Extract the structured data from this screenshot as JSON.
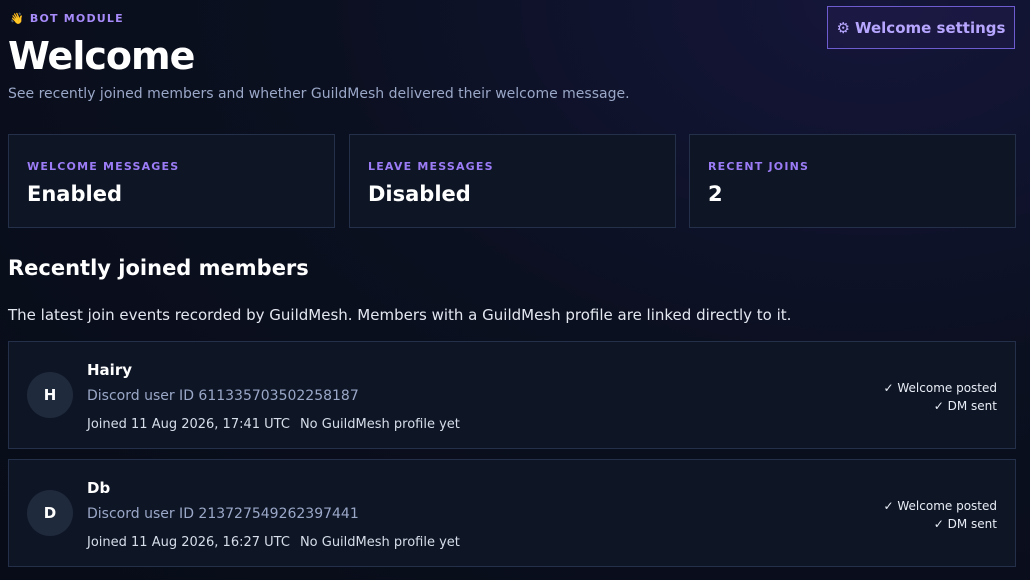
{
  "header": {
    "eyebrow_icon": "👋",
    "eyebrow": "BOT MODULE",
    "title": "Welcome",
    "subtitle": "See recently joined members and whether GuildMesh delivered their welcome message.",
    "settings_icon": "⚙",
    "settings_label": "Welcome settings"
  },
  "stats": [
    {
      "label": "WELCOME MESSAGES",
      "value": "Enabled"
    },
    {
      "label": "LEAVE MESSAGES",
      "value": "Disabled"
    },
    {
      "label": "RECENT JOINS",
      "value": "2"
    }
  ],
  "members_section": {
    "title": "Recently joined members",
    "description": "The latest join events recorded by GuildMesh. Members with a GuildMesh profile are linked directly to it."
  },
  "members": [
    {
      "initial": "H",
      "name": "Hairy",
      "user_id": "Discord user ID 611335703502258187",
      "joined": "Joined 11 Aug 2026, 17:41 UTC",
      "profile": "No GuildMesh profile yet",
      "status_1": "✓ Welcome posted",
      "status_2": "✓ DM sent"
    },
    {
      "initial": "D",
      "name": "Db",
      "user_id": "Discord user ID 213727549262397441",
      "joined": "Joined 11 Aug 2026, 16:27 UTC",
      "profile": "No GuildMesh profile yet",
      "status_1": "✓ Welcome posted",
      "status_2": "✓ DM sent"
    }
  ],
  "colors": {
    "accent": "#a78bfa",
    "background": "#0b1020",
    "card": "#0e1626",
    "border": "#243049"
  }
}
